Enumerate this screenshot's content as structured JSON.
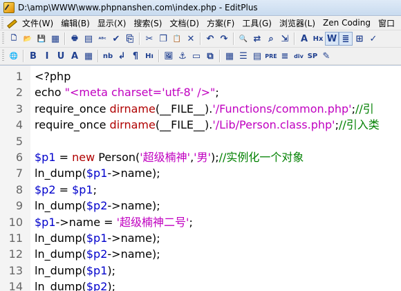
{
  "window": {
    "title": "D:\\amp\\WWW\\www.phpnanshen.com\\index.php - EditPlus"
  },
  "menu": [
    "文件(W)",
    "编辑(B)",
    "显示(X)",
    "搜索(S)",
    "文档(D)",
    "方案(F)",
    "工具(G)",
    "浏览器(L)",
    "Zen Coding",
    "窗口"
  ],
  "toolbar1": [
    {
      "name": "new-file-icon",
      "glyph": "🗋"
    },
    {
      "name": "open-file-icon",
      "glyph": "📂"
    },
    {
      "name": "save-icon",
      "glyph": "💾"
    },
    {
      "name": "save-all-icon",
      "glyph": "▦"
    },
    {
      "sep": true
    },
    {
      "name": "print-icon",
      "glyph": "🖶"
    },
    {
      "name": "print-preview-icon",
      "glyph": "▤"
    },
    {
      "name": "spell-check-icon",
      "glyph": "ᴬᴮᶜ"
    },
    {
      "name": "check-icon",
      "glyph": "✔"
    },
    {
      "name": "ftp-icon",
      "glyph": "⎘"
    },
    {
      "sep": true
    },
    {
      "name": "cut-icon",
      "glyph": "✂"
    },
    {
      "name": "copy-icon",
      "glyph": "❐"
    },
    {
      "name": "paste-icon",
      "glyph": "📋"
    },
    {
      "name": "delete-icon",
      "glyph": "✕"
    },
    {
      "sep": true
    },
    {
      "name": "undo-icon",
      "glyph": "↶"
    },
    {
      "name": "redo-icon",
      "glyph": "↷"
    },
    {
      "sep": true
    },
    {
      "name": "find-icon",
      "glyph": "🔍"
    },
    {
      "name": "replace-icon",
      "glyph": "⇄"
    },
    {
      "name": "find-in-files-icon",
      "glyph": "⌕"
    },
    {
      "name": "goto-icon",
      "glyph": "⇲"
    },
    {
      "sep": true
    },
    {
      "name": "font-icon",
      "glyph": "A"
    },
    {
      "name": "hex-icon",
      "glyph": "Hx"
    },
    {
      "name": "word-wrap-icon",
      "glyph": "W"
    },
    {
      "name": "line-numbers-icon",
      "glyph": "≣"
    },
    {
      "name": "ruler-icon",
      "glyph": "⊞"
    },
    {
      "name": "spellcheck-mark-icon",
      "glyph": "✓"
    }
  ],
  "toolbar2": [
    {
      "name": "browser-icon",
      "glyph": "🌐"
    },
    {
      "sep": true
    },
    {
      "name": "bold-icon",
      "glyph": "B"
    },
    {
      "name": "italic-icon",
      "glyph": "I"
    },
    {
      "name": "underline-icon",
      "glyph": "U"
    },
    {
      "name": "font-color-icon",
      "glyph": "A"
    },
    {
      "name": "color-palette-icon",
      "glyph": "▦"
    },
    {
      "sep": true
    },
    {
      "name": "nbsp-icon",
      "glyph": "nb"
    },
    {
      "name": "br-icon",
      "glyph": "↲"
    },
    {
      "name": "paragraph-icon",
      "glyph": "¶"
    },
    {
      "name": "heading-icon",
      "glyph": "Hı"
    },
    {
      "sep": true
    },
    {
      "name": "image-icon",
      "glyph": "🖼"
    },
    {
      "name": "anchor-icon",
      "glyph": "⚓"
    },
    {
      "name": "hr-icon",
      "glyph": "▭"
    },
    {
      "name": "comment-icon",
      "glyph": "⧉"
    },
    {
      "sep": true
    },
    {
      "name": "table-icon",
      "glyph": "▦"
    },
    {
      "name": "list-icon",
      "glyph": "☰"
    },
    {
      "name": "form-icon",
      "glyph": "▤"
    },
    {
      "name": "pre-icon",
      "glyph": "PRE"
    },
    {
      "name": "center-icon",
      "glyph": "≡"
    },
    {
      "name": "div-icon",
      "glyph": "div"
    },
    {
      "name": "span-icon",
      "glyph": "SP"
    },
    {
      "name": "edit-icon",
      "glyph": "✎"
    }
  ],
  "code": [
    [
      {
        "t": "<?php",
        "c": "plain"
      }
    ],
    [
      {
        "t": "echo ",
        "c": "plain"
      },
      {
        "t": "\"<meta charset='utf-8' />\"",
        "c": "str"
      },
      {
        "t": ";",
        "c": "plain"
      }
    ],
    [
      {
        "t": "require_once ",
        "c": "plain"
      },
      {
        "t": "dirname",
        "c": "fn"
      },
      {
        "t": "(__FILE__)",
        "c": "plain"
      },
      {
        "t": ".",
        "c": "plain"
      },
      {
        "t": "'/Functions/common.php'",
        "c": "str"
      },
      {
        "t": ";",
        "c": "plain"
      },
      {
        "t": "//引",
        "c": "com"
      }
    ],
    [
      {
        "t": "require_once ",
        "c": "plain"
      },
      {
        "t": "dirname",
        "c": "fn"
      },
      {
        "t": "(__FILE__)",
        "c": "plain"
      },
      {
        "t": ".",
        "c": "plain"
      },
      {
        "t": "'/Lib/Person.class.php'",
        "c": "str"
      },
      {
        "t": ";",
        "c": "plain"
      },
      {
        "t": "//引入类",
        "c": "com"
      }
    ],
    [
      {
        "t": "",
        "c": "plain"
      }
    ],
    [
      {
        "t": "$p1",
        "c": "var"
      },
      {
        "t": " = ",
        "c": "plain"
      },
      {
        "t": "new",
        "c": "fn"
      },
      {
        "t": " Person(",
        "c": "plain"
      },
      {
        "t": "'超级楠神'",
        "c": "str"
      },
      {
        "t": ",",
        "c": "plain"
      },
      {
        "t": "'男'",
        "c": "str"
      },
      {
        "t": ");",
        "c": "plain"
      },
      {
        "t": "//实例化一个对象",
        "c": "com"
      }
    ],
    [
      {
        "t": "ln_dump(",
        "c": "plain"
      },
      {
        "t": "$p1",
        "c": "var"
      },
      {
        "t": "->name);",
        "c": "plain"
      }
    ],
    [
      {
        "t": "$p2",
        "c": "var"
      },
      {
        "t": " = ",
        "c": "plain"
      },
      {
        "t": "$p1",
        "c": "var"
      },
      {
        "t": ";",
        "c": "plain"
      }
    ],
    [
      {
        "t": "ln_dump(",
        "c": "plain"
      },
      {
        "t": "$p2",
        "c": "var"
      },
      {
        "t": "->name);",
        "c": "plain"
      }
    ],
    [
      {
        "t": "$p1",
        "c": "var"
      },
      {
        "t": "->name = ",
        "c": "plain"
      },
      {
        "t": "'超级楠神二号'",
        "c": "str"
      },
      {
        "t": ";",
        "c": "plain"
      }
    ],
    [
      {
        "t": "ln_dump(",
        "c": "plain"
      },
      {
        "t": "$p1",
        "c": "var"
      },
      {
        "t": "->name);",
        "c": "plain"
      }
    ],
    [
      {
        "t": "ln_dump(",
        "c": "plain"
      },
      {
        "t": "$p2",
        "c": "var"
      },
      {
        "t": "->name);",
        "c": "plain"
      }
    ],
    [
      {
        "t": "ln_dump(",
        "c": "plain"
      },
      {
        "t": "$p1",
        "c": "var"
      },
      {
        "t": ");",
        "c": "plain"
      }
    ],
    [
      {
        "t": "ln_dump(",
        "c": "plain"
      },
      {
        "t": "$p2",
        "c": "var"
      },
      {
        "t": ");",
        "c": "plain"
      }
    ]
  ],
  "colors": {
    "string": "#c000c0",
    "function": "#b00000",
    "variable": "#0000cc",
    "comment": "#008000"
  }
}
